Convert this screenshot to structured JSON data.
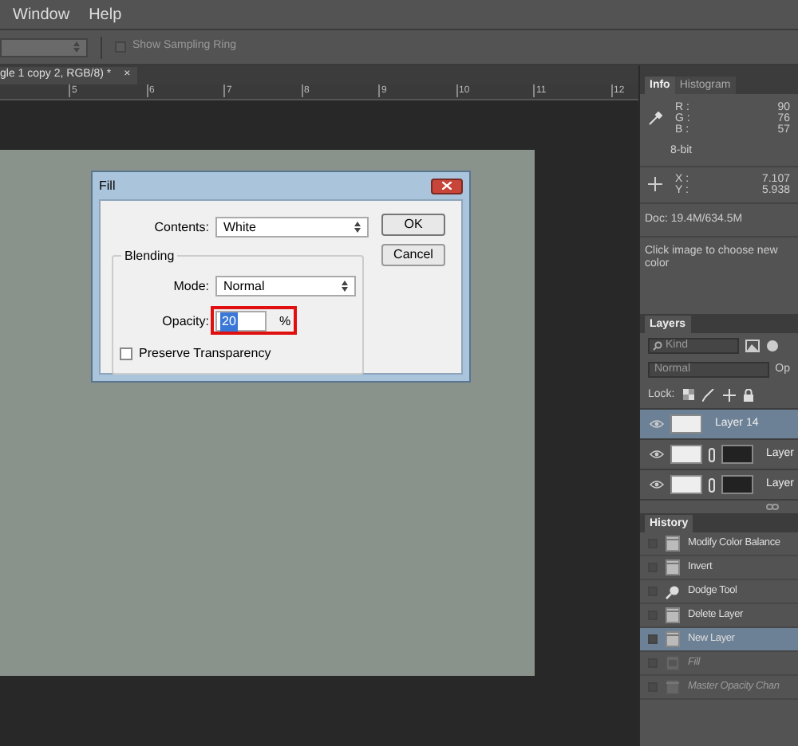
{
  "menu": [
    "Window",
    "Help"
  ],
  "options_bar": {
    "sampling_ring": {
      "label": "Show Sampling Ring",
      "checked": false
    }
  },
  "document_tab": {
    "title": "gle 1 copy 2, RGB/8) *",
    "close": "×"
  },
  "ruler": [
    "5",
    "6",
    "7",
    "8",
    "9",
    "10",
    "11",
    "12"
  ],
  "info_panel": {
    "tabs": [
      {
        "label": "Info",
        "selected": true
      },
      {
        "label": "Histogram",
        "selected": false
      }
    ],
    "rgb": [
      {
        "label": "R :",
        "value": "90"
      },
      {
        "label": "G :",
        "value": "76"
      },
      {
        "label": "B :",
        "value": "57"
      }
    ],
    "bit_depth": "8-bit",
    "xy": [
      {
        "label": "X :",
        "value": "7.107"
      },
      {
        "label": "Y :",
        "value": "5.938"
      }
    ],
    "doc": "Doc: 19.4M/634.5M",
    "hint": "Click image to choose new color"
  },
  "layers_panel": {
    "tab": "Layers",
    "filter": "Kind",
    "blend_mode": "Normal",
    "opacity_label": "Op",
    "lock_label": "Lock:",
    "layers": [
      {
        "name": "Layer 14",
        "kind": "plain",
        "selected": true,
        "visible": true
      },
      {
        "name": "Layer",
        "kind": "masked",
        "selected": false,
        "visible": true
      },
      {
        "name": "Layer",
        "kind": "masked",
        "selected": false,
        "visible": true
      }
    ]
  },
  "history_panel": {
    "tab": "History",
    "items": [
      {
        "label": "Modify Color Balance",
        "kind": "step",
        "selected": false,
        "disabled": false
      },
      {
        "label": "Invert",
        "kind": "step",
        "selected": false,
        "disabled": false
      },
      {
        "label": "Dodge Tool",
        "kind": "tool",
        "selected": false,
        "disabled": false
      },
      {
        "label": "Delete Layer",
        "kind": "step",
        "selected": false,
        "disabled": false
      },
      {
        "label": "New Layer",
        "kind": "step",
        "selected": true,
        "disabled": false
      },
      {
        "label": "Fill",
        "kind": "fill",
        "selected": false,
        "disabled": true
      },
      {
        "label": "Master Opacity Chan",
        "kind": "step",
        "selected": false,
        "disabled": true
      }
    ]
  },
  "dialog": {
    "title": "Fill",
    "contents_label": "Contents:",
    "contents_value": "White",
    "ok": "OK",
    "cancel": "Cancel",
    "blending_label": "Blending",
    "mode_label": "Mode:",
    "mode_value": "Normal",
    "opacity_label": "Opacity:",
    "opacity_value": "20",
    "percent": "%",
    "preserve": {
      "label": "Preserve Transparency",
      "checked": false
    }
  }
}
